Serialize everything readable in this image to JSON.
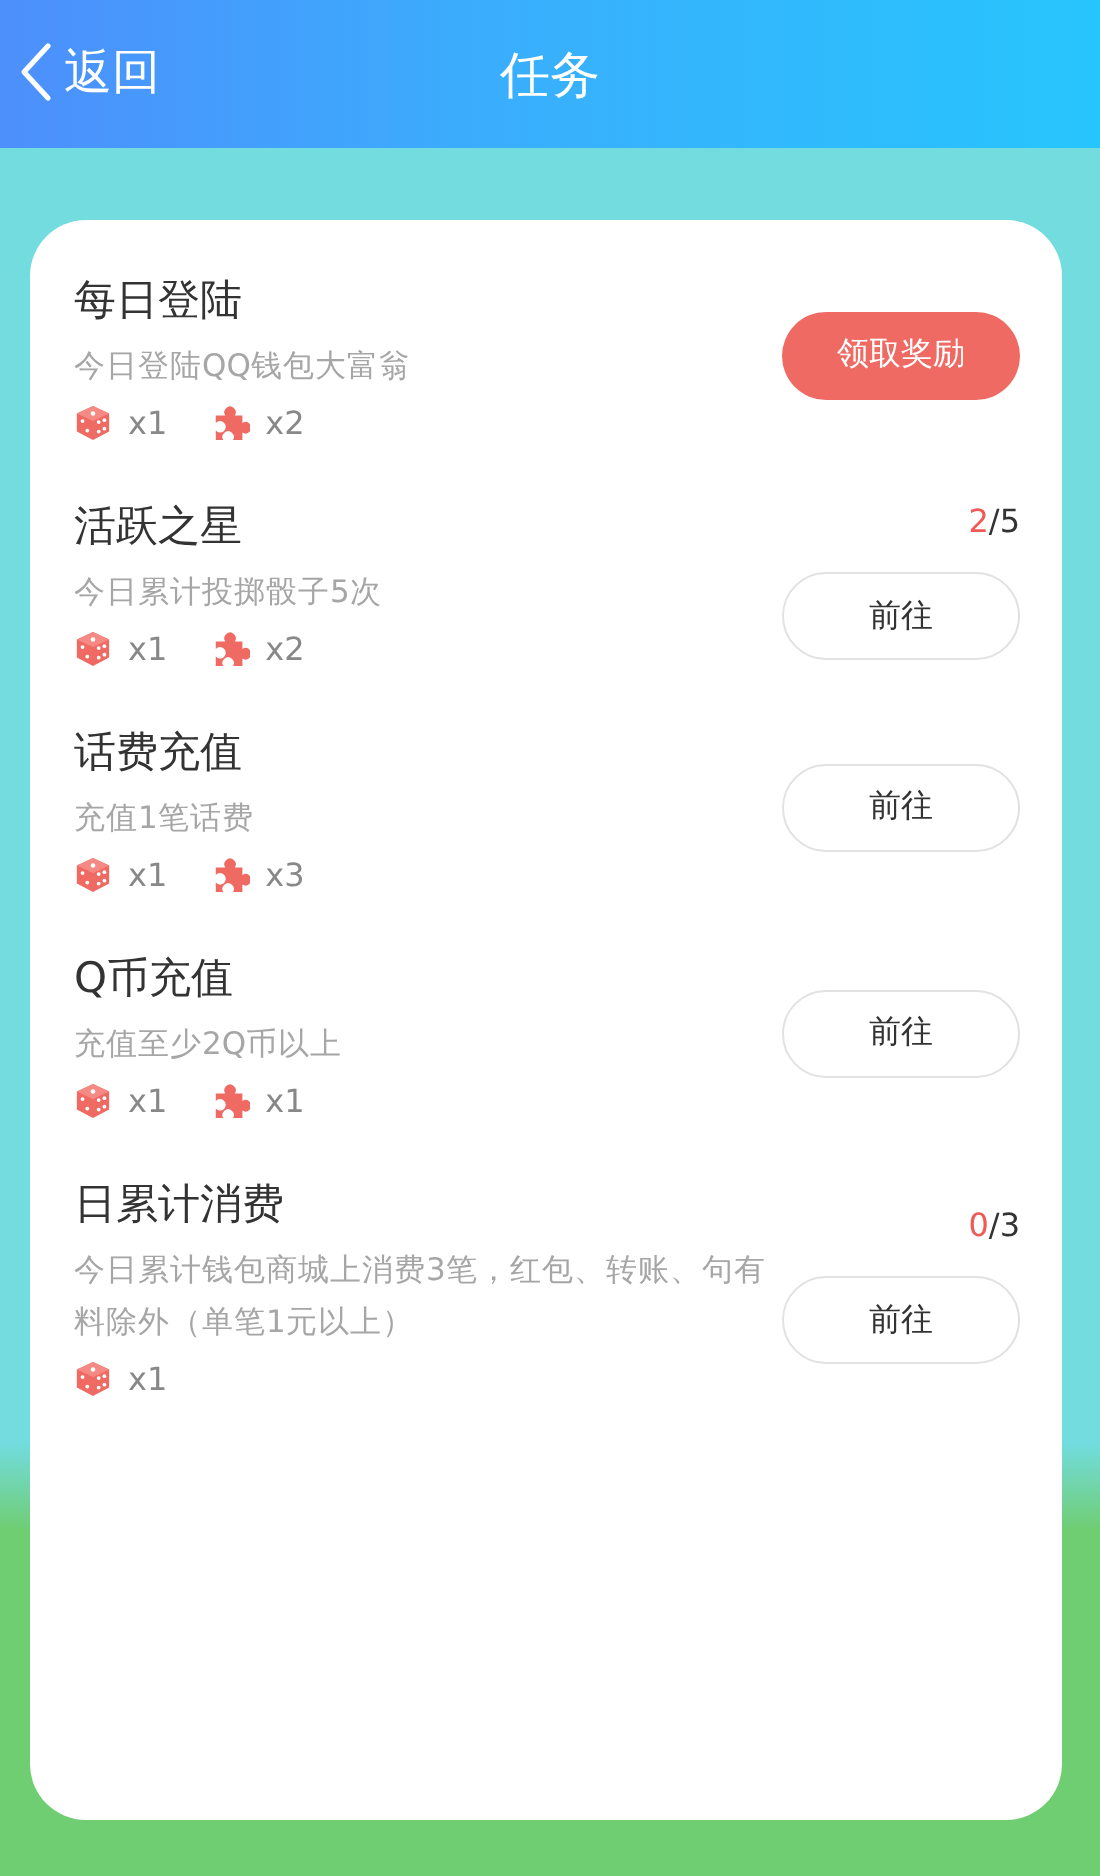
{
  "header": {
    "back_label": "返回",
    "title": "任务"
  },
  "tasks": [
    {
      "title": "每日登陆",
      "description": "今日登陆QQ钱包大富翁",
      "rewards": [
        {
          "kind": "dice",
          "count": "x1"
        },
        {
          "kind": "puzzle",
          "count": "x2"
        }
      ],
      "button": {
        "kind": "claim",
        "label": "领取奖励"
      }
    },
    {
      "title": "活跃之星",
      "description": "今日累计投掷骰子5次",
      "progress": {
        "done": "2",
        "total": "/5"
      },
      "rewards": [
        {
          "kind": "dice",
          "count": "x1"
        },
        {
          "kind": "puzzle",
          "count": "x2"
        }
      ],
      "button": {
        "kind": "go",
        "label": "前往"
      }
    },
    {
      "title": "话费充值",
      "description": "充值1笔话费",
      "rewards": [
        {
          "kind": "dice",
          "count": "x1"
        },
        {
          "kind": "puzzle",
          "count": "x3"
        }
      ],
      "button": {
        "kind": "go",
        "label": "前往"
      }
    },
    {
      "title": "Q币充值",
      "description": "充值至少2Q币以上",
      "rewards": [
        {
          "kind": "dice",
          "count": "x1"
        },
        {
          "kind": "puzzle",
          "count": "x1"
        }
      ],
      "button": {
        "kind": "go",
        "label": "前往"
      }
    },
    {
      "title": "日累计消费",
      "description": "今日累计钱包商城上消费3笔，红包、转账、句有料除外（单笔1元以上）",
      "progress": {
        "done": "0",
        "total": "/3"
      },
      "rewards": [
        {
          "kind": "dice",
          "count": "x1"
        }
      ],
      "button": {
        "kind": "go",
        "label": "前往"
      }
    }
  ]
}
